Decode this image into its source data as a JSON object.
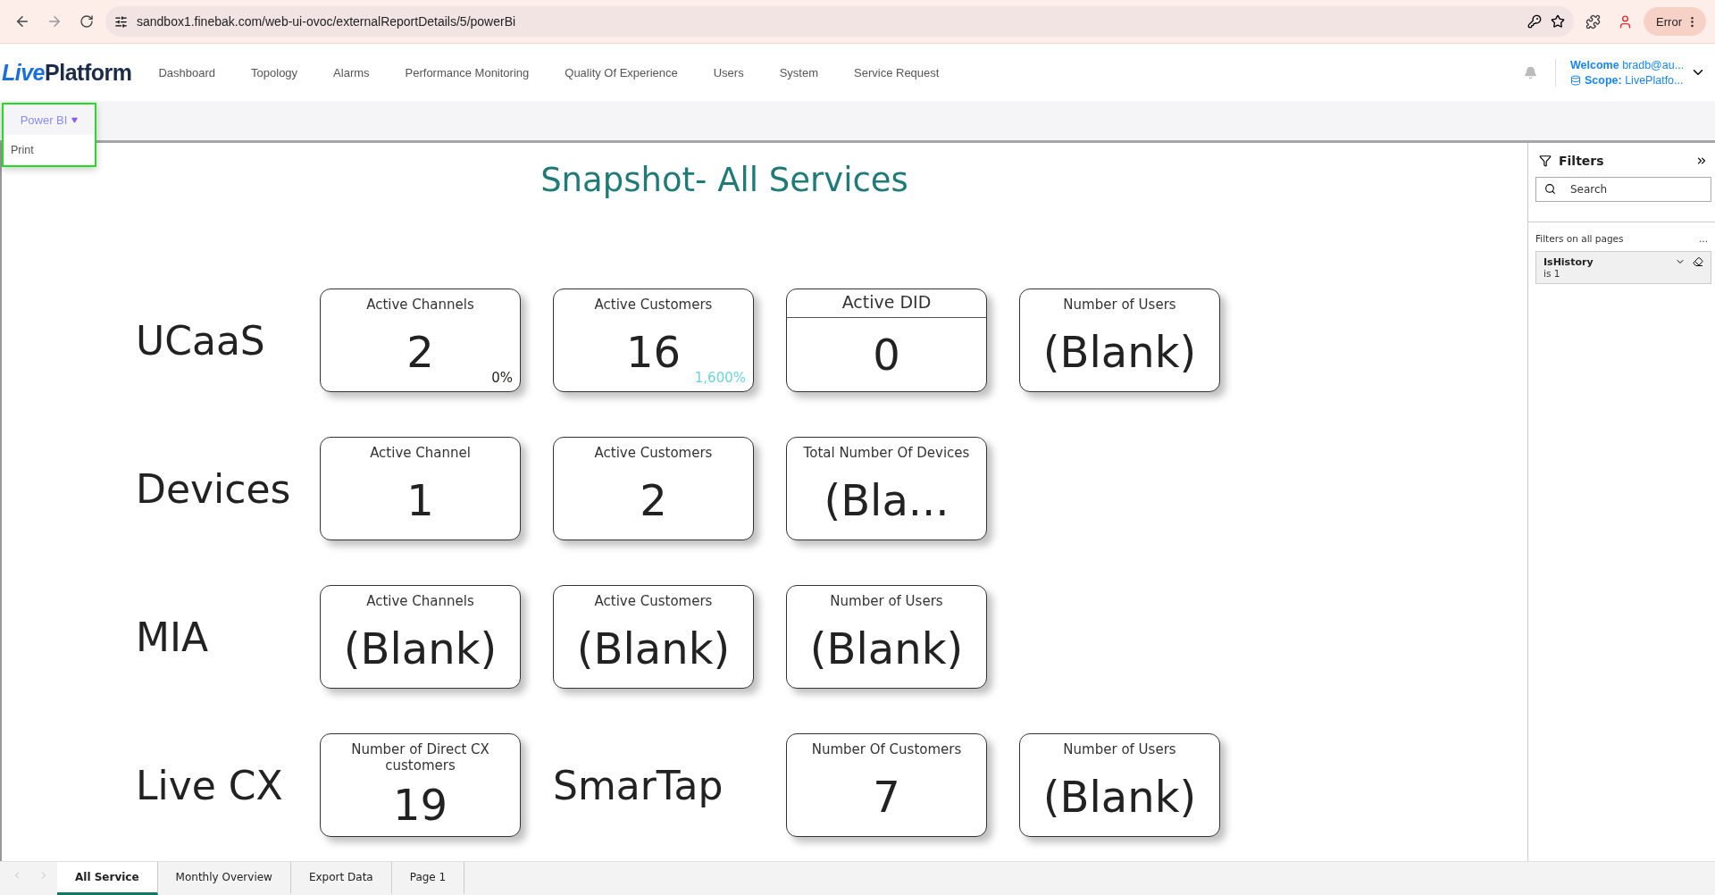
{
  "browser": {
    "url": "sandbox1.finebak.com/web-ui-ovoc/externalReportDetails/5/powerBi",
    "profile_status": "Error"
  },
  "nav": {
    "logo_prefix": "Live",
    "logo_suffix": "Platform",
    "items": [
      "Dashboard",
      "Topology",
      "Alarms",
      "Performance Monitoring",
      "Quality Of Experience",
      "Users",
      "System",
      "Service Request"
    ],
    "welcome": "**Welcome** bradb@au...",
    "scope": "**Scope:** LivePlatfo..."
  },
  "toolbar": {
    "menu_label": "Power BI",
    "expanded": true,
    "menu_items": [
      "Print"
    ]
  },
  "report": {
    "title": "Snapshot- All Services",
    "rows": [
      {
        "items": [
          {
            "kind": "label",
            "text": "UCaaS"
          },
          {
            "kind": "card",
            "title": "Active Channels",
            "value": "2",
            "delta": "0%",
            "color": "#252423"
          },
          {
            "kind": "card",
            "title": "Active Customers",
            "value": "16",
            "delta": "1,600%",
            "color": "#6fd3dc"
          },
          {
            "kind": "divided",
            "title": "Active DID",
            "value": "0"
          },
          {
            "kind": "card",
            "title": "Number of Users",
            "value": "(Blank)"
          }
        ]
      },
      {
        "items": [
          {
            "kind": "label",
            "text": "Devices"
          },
          {
            "kind": "card",
            "title": "Active Channel",
            "value": "1"
          },
          {
            "kind": "card",
            "title": "Active Customers",
            "value": "2"
          },
          {
            "kind": "card",
            "title": "Total Number Of Devices",
            "value": "(Bla..."
          }
        ]
      },
      {
        "items": [
          {
            "kind": "label",
            "text": "MIA"
          },
          {
            "kind": "card",
            "title": "Active Channels",
            "value": "(Blank)"
          },
          {
            "kind": "card",
            "title": "Active Customers",
            "value": "(Blank)"
          },
          {
            "kind": "card",
            "title": "Number of Users",
            "value": "(Blank)"
          }
        ]
      },
      {
        "items": [
          {
            "kind": "label",
            "text": "Live CX"
          },
          {
            "kind": "card",
            "title": "Number of Direct CX customers",
            "value": "19"
          },
          {
            "kind": "label",
            "text": "SmarTap"
          },
          {
            "kind": "card",
            "title": "Number Of Customers",
            "value": "7"
          },
          {
            "kind": "card",
            "title": "Number of Users",
            "value": "(Blank)"
          }
        ]
      }
    ]
  },
  "filters": {
    "title": "Filters",
    "search": {
      "placeholder": "Search"
    },
    "section": "Filters on all pages",
    "more": "...",
    "items": [
      {
        "name": "IsHistory",
        "condition": "is 1"
      }
    ]
  },
  "page_tabs": [
    {
      "label": "All Service",
      "selected": true
    },
    {
      "label": "Monthly Overview",
      "selected": false
    },
    {
      "label": "Export Data",
      "selected": false
    },
    {
      "label": "Page 1",
      "selected": false
    }
  ]
}
